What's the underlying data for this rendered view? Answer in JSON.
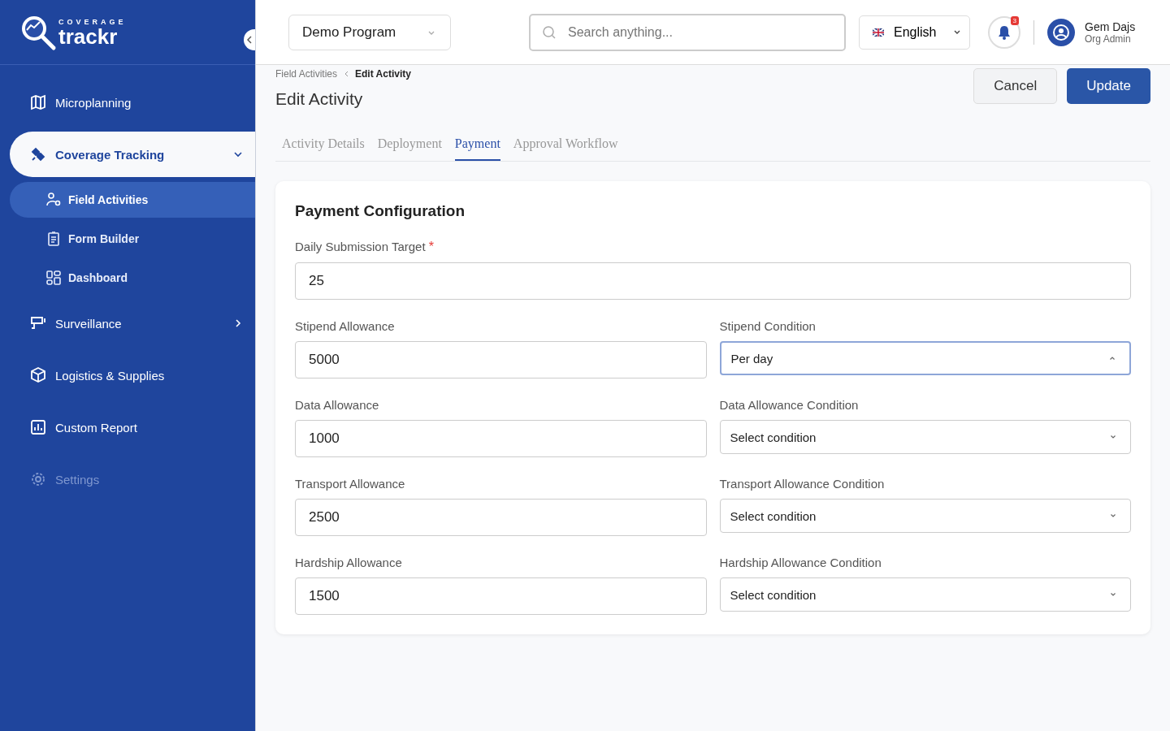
{
  "sidebar": {
    "logo": {
      "small": "COVERAGE",
      "large": "trackr"
    },
    "items": [
      {
        "label": "Microplanning",
        "selected": false,
        "disabled": false
      },
      {
        "label": "Coverage Tracking",
        "selected": true,
        "disabled": false,
        "expanded": true,
        "children": [
          {
            "label": "Field Activities",
            "selected": true
          },
          {
            "label": "Form Builder",
            "selected": false
          },
          {
            "label": "Dashboard",
            "selected": false
          }
        ]
      },
      {
        "label": "Surveillance",
        "selected": false,
        "disabled": false,
        "expanded": false
      },
      {
        "label": "Logistics & Supplies",
        "selected": false,
        "disabled": false
      },
      {
        "label": "Custom Report",
        "selected": false,
        "disabled": false
      },
      {
        "label": "Settings",
        "selected": false,
        "disabled": true
      }
    ]
  },
  "header": {
    "program": "Demo Program",
    "search": {
      "placeholder": "Search anything..."
    },
    "language": "English",
    "notifications": "3",
    "user": {
      "name": "Gem Dajs",
      "role": "Org Admin"
    }
  },
  "breadcrumb": [
    "Field Activities",
    "Edit Activity"
  ],
  "page_title": "Edit Activity",
  "buttons": {
    "cancel": "Cancel",
    "update": "Update"
  },
  "tabs": [
    {
      "label": "Activity Details",
      "selected": false
    },
    {
      "label": "Deployment",
      "selected": false
    },
    {
      "label": "Payment",
      "selected": true
    },
    {
      "label": "Approval Workflow",
      "selected": false
    }
  ],
  "card": {
    "title": "Payment Configuration",
    "target": {
      "label": "Daily Submission Target",
      "required_mark": "*",
      "value": "25"
    },
    "rows": [
      {
        "amount": {
          "label": "Stipend Allowance",
          "value": "5000"
        },
        "condition": {
          "label": "Stipend Condition",
          "value": "Per day",
          "expanded": true
        }
      },
      {
        "amount": {
          "label": "Data Allowance",
          "value": "1000"
        },
        "condition": {
          "label": "Data Allowance Condition",
          "value": "Select condition",
          "expanded": false
        }
      },
      {
        "amount": {
          "label": "Transport Allowance",
          "value": "2500"
        },
        "condition": {
          "label": "Transport Allowance Condition",
          "value": "Select condition",
          "expanded": false
        }
      },
      {
        "amount": {
          "label": "Hardship Allowance",
          "value": "1500"
        },
        "condition": {
          "label": "Hardship Allowance Condition",
          "value": "Select condition",
          "expanded": false
        }
      }
    ]
  }
}
